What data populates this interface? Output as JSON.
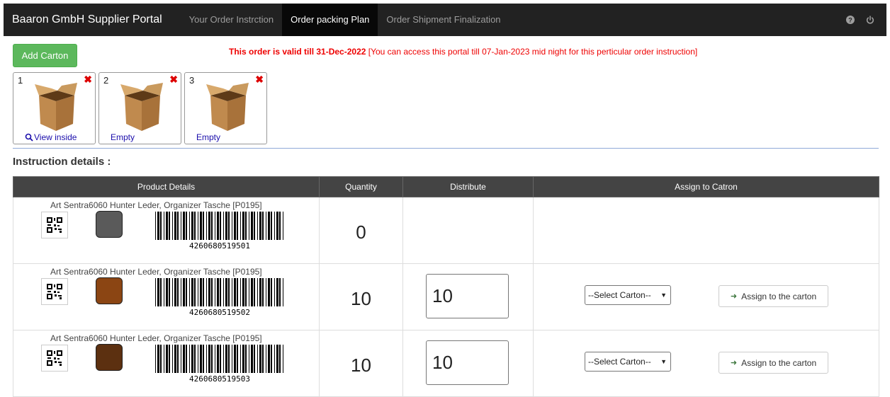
{
  "navbar": {
    "brand": "Baaron GmbH Supplier Portal",
    "items": [
      {
        "label": "Your Order Instrction",
        "active": false
      },
      {
        "label": "Order packing Plan",
        "active": true
      },
      {
        "label": "Order Shipment Finalization",
        "active": false
      }
    ],
    "icons": [
      "question-icon",
      "power-icon"
    ]
  },
  "toolbar": {
    "add_carton_label": "Add Carton"
  },
  "validity": {
    "bold": "This order is valid till 31-Dec-2022",
    "rest": " [You can access this portal till 07-Jan-2023 mid night for this perticular order instruction]"
  },
  "cartons": [
    {
      "number": "1",
      "link": "View inside",
      "has_search_icon": true
    },
    {
      "number": "2",
      "link": "Empty",
      "has_search_icon": false
    },
    {
      "number": "3",
      "link": "Empty",
      "has_search_icon": false
    }
  ],
  "section_title": "Instruction details :",
  "table": {
    "headers": [
      "Product Details",
      "Quantity",
      "Distribute",
      "Assign to Catron"
    ],
    "rows": [
      {
        "title": "Art Sentra6060 Hunter Leder, Organizer Tasche [P0195]",
        "color": "#5a5a5a",
        "barcode": "4260680519501",
        "quantity": "0",
        "distribute": "",
        "select": "",
        "assign": ""
      },
      {
        "title": "Art Sentra6060 Hunter Leder, Organizer Tasche [P0195]",
        "color": "#8b4513",
        "barcode": "4260680519502",
        "quantity": "10",
        "distribute": "10",
        "select": "--Select Carton--",
        "assign": "Assign to the carton"
      },
      {
        "title": "Art Sentra6060 Hunter Leder, Organizer Tasche [P0195]",
        "color": "#5c3010",
        "barcode": "4260680519503",
        "quantity": "10",
        "distribute": "10",
        "select": "--Select Carton--",
        "assign": "Assign to the carton"
      }
    ]
  }
}
